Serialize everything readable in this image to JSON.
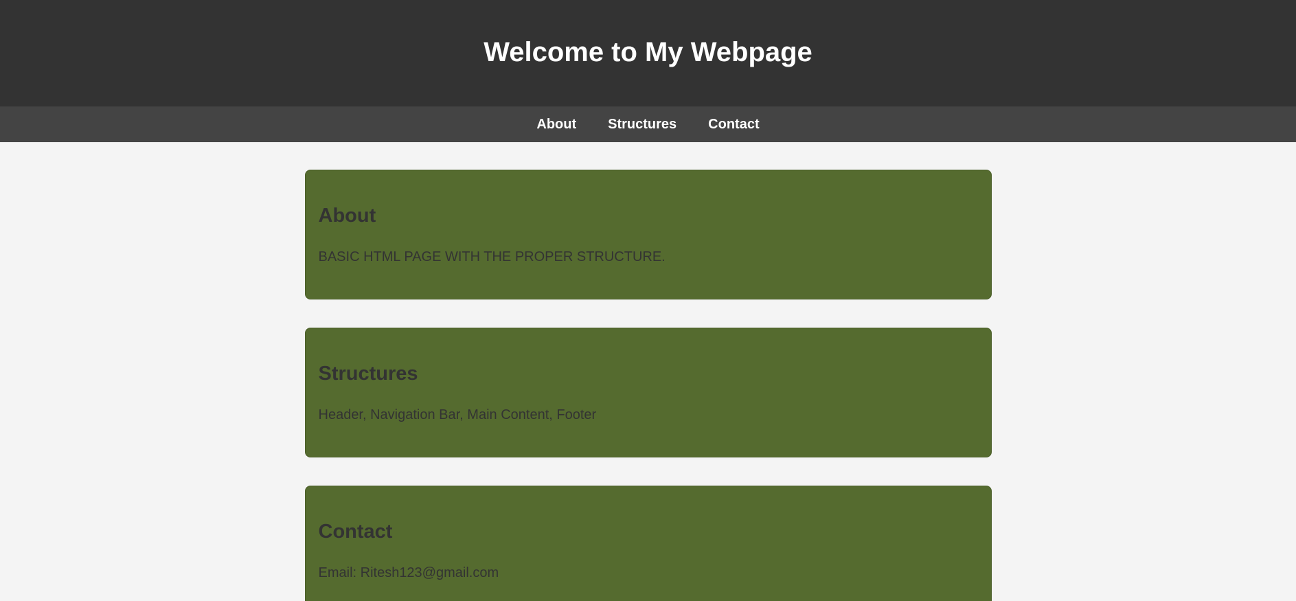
{
  "header": {
    "title": "Welcome to My Webpage"
  },
  "nav": {
    "items": [
      {
        "label": "About"
      },
      {
        "label": "Structures"
      },
      {
        "label": "Contact"
      }
    ]
  },
  "sections": [
    {
      "heading": "About",
      "text": "BASIC HTML PAGE WITH THE PROPER STRUCTURE."
    },
    {
      "heading": "Structures",
      "text": "Header, Navigation Bar, Main Content, Footer"
    },
    {
      "heading": "Contact",
      "text": "Email: Ritesh123@gmail.com"
    }
  ],
  "colors": {
    "header_bg": "#333333",
    "nav_bg": "#444444",
    "page_bg": "#f4f4f4",
    "card_bg": "#556b2f",
    "text": "#333333"
  }
}
